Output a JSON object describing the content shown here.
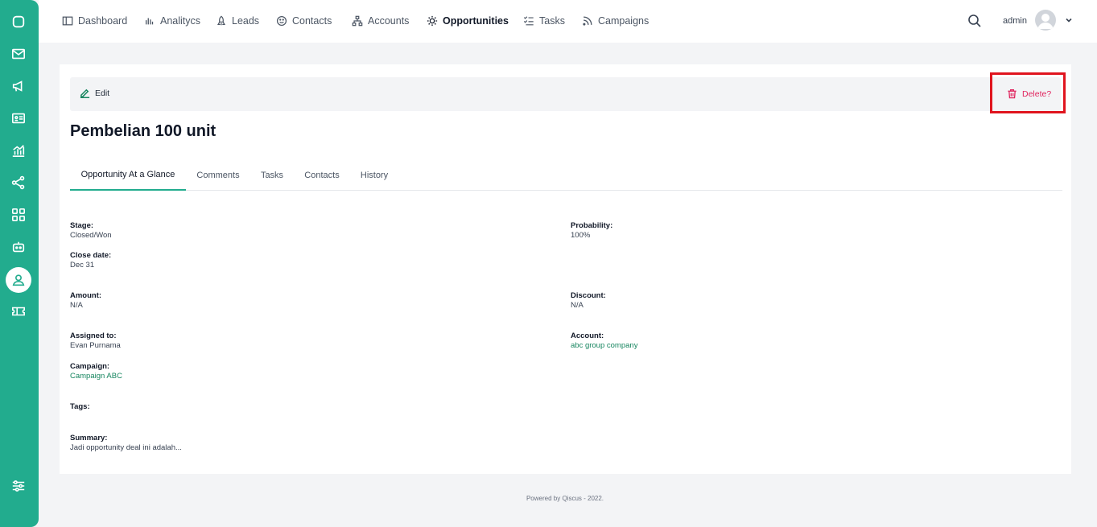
{
  "nav": {
    "items": [
      {
        "label": "Dashboard"
      },
      {
        "label": "Analitycs"
      },
      {
        "label": "Leads"
      },
      {
        "label": "Contacts"
      },
      {
        "label": "Accounts"
      },
      {
        "label": "Opportunities"
      },
      {
        "label": "Tasks"
      },
      {
        "label": "Campaigns"
      }
    ],
    "user": "admin"
  },
  "toolbar": {
    "edit_label": "Edit",
    "delete_label": "Delete?"
  },
  "opportunity": {
    "title": "Pembelian 100 unit"
  },
  "tabs": [
    {
      "label": "Opportunity At a Glance"
    },
    {
      "label": "Comments"
    },
    {
      "label": "Tasks"
    },
    {
      "label": "Contacts"
    },
    {
      "label": "History"
    }
  ],
  "fields": {
    "stage": {
      "label": "Stage:",
      "value": "Closed/Won"
    },
    "probability": {
      "label": "Probability:",
      "value": "100%"
    },
    "close_date": {
      "label": "Close date:",
      "value": "Dec 31"
    },
    "amount": {
      "label": "Amount:",
      "value": "N/A"
    },
    "discount": {
      "label": "Discount:",
      "value": "N/A"
    },
    "assigned_to": {
      "label": "Assigned to:",
      "value": "Evan Purnama"
    },
    "account": {
      "label": "Account:",
      "value": "abc group company"
    },
    "campaign": {
      "label": "Campaign:",
      "value": "Campaign ABC"
    },
    "tags": {
      "label": "Tags:",
      "value": ""
    },
    "summary": {
      "label": "Summary:",
      "value": "Jadi opportunity deal ini adalah..."
    }
  },
  "footer": "Powered by Qiscus - 2022.",
  "colors": {
    "brand": "#22ac8e",
    "danger": "#e0245e",
    "highlight": "#e0141e"
  },
  "icons": {
    "sidebar": [
      "chat-icon",
      "mail-icon",
      "megaphone-icon",
      "id-card-icon",
      "chart-icon",
      "share-icon",
      "grid-icon",
      "bot-icon",
      "user-icon",
      "ticket-icon",
      "settings-sliders-icon"
    ]
  }
}
